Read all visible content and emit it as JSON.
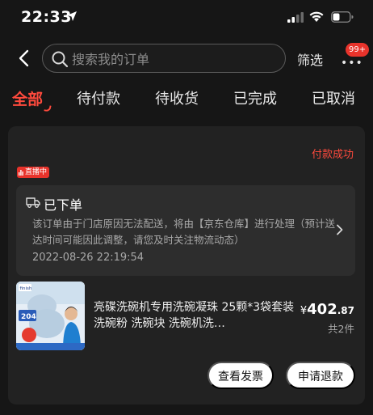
{
  "status_bar": {
    "time": "22:33"
  },
  "header": {
    "search_placeholder": "搜索我的订单",
    "filter_label": "筛选",
    "more_label": "•••",
    "badge": "99+"
  },
  "tabs": [
    {
      "label": "全部",
      "active": true
    },
    {
      "label": "待付款",
      "active": false
    },
    {
      "label": "待收货",
      "active": false
    },
    {
      "label": "已完成",
      "active": false
    },
    {
      "label": "已取消",
      "active": false
    }
  ],
  "order": {
    "status": "付款成功",
    "live_badge": "直播中",
    "logistics": {
      "title": "已下单",
      "message": "该订单由于门店原因无法配送，将由【京东仓库】进行处理（预计送达时间可能因此调整，请您及时关注物流动态）",
      "time": "2022-08-26 22:19:54"
    },
    "product": {
      "name": "亮碟洗碗机专用洗碗凝珠 25颗*3袋套装 洗碗粉 洗碗块 洗碗机洗…",
      "price_symbol": "¥",
      "price_int": "402",
      "price_dec": ".87",
      "quantity": "共2件",
      "image_brand": "finish",
      "image_tag": "204"
    },
    "buttons": {
      "invoice": "查看发票",
      "refund": "申请退款"
    }
  },
  "colors": {
    "accent": "#ff4a3d",
    "background": "#161616",
    "card": "#222222"
  }
}
